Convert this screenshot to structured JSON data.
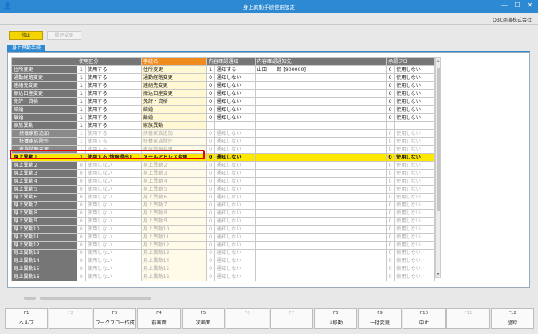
{
  "window": {
    "title": "身上異動手続使用設定",
    "company": "OBC商事株式会社"
  },
  "toolbar": {
    "edit_label": "修正",
    "history_label": "履歴変更"
  },
  "tab": {
    "label": "身上異動手続"
  },
  "columns": {
    "category": "",
    "use": "使用区分",
    "procedure": "手続名",
    "notify": "内容確認通知",
    "notify_to": "内容確認通知先",
    "approval": "承認フロー"
  },
  "rows": [
    {
      "label": "住所変更",
      "sub": false,
      "use_code": "1",
      "use_text": "使用する",
      "proc": "住所変更",
      "n_code": "1",
      "n_text": "通知する",
      "notify_to": "山田　一郎 [900000]",
      "a_code": "0",
      "a_text": "使用しない",
      "dis": false
    },
    {
      "label": "通勤経路変更",
      "sub": false,
      "use_code": "1",
      "use_text": "使用する",
      "proc": "通勤経路変更",
      "n_code": "0",
      "n_text": "通知しない",
      "notify_to": "",
      "a_code": "0",
      "a_text": "使用しない",
      "dis": false
    },
    {
      "label": "連絡先変更",
      "sub": false,
      "use_code": "1",
      "use_text": "使用する",
      "proc": "連絡先変更",
      "n_code": "0",
      "n_text": "通知しない",
      "notify_to": "",
      "a_code": "0",
      "a_text": "使用しない",
      "dis": false
    },
    {
      "label": "振込口座変更",
      "sub": false,
      "use_code": "1",
      "use_text": "使用する",
      "proc": "振込口座変更",
      "n_code": "0",
      "n_text": "通知しない",
      "notify_to": "",
      "a_code": "0",
      "a_text": "使用しない",
      "dis": false
    },
    {
      "label": "免許・資格",
      "sub": false,
      "use_code": "1",
      "use_text": "使用する",
      "proc": "免許・資格",
      "n_code": "0",
      "n_text": "通知しない",
      "notify_to": "",
      "a_code": "0",
      "a_text": "使用しない",
      "dis": false
    },
    {
      "label": "結婚",
      "sub": false,
      "use_code": "1",
      "use_text": "使用する",
      "proc": "結婚",
      "n_code": "0",
      "n_text": "通知しない",
      "notify_to": "",
      "a_code": "0",
      "a_text": "使用しない",
      "dis": false
    },
    {
      "label": "離婚",
      "sub": false,
      "use_code": "1",
      "use_text": "使用する",
      "proc": "離婚",
      "n_code": "0",
      "n_text": "通知しない",
      "notify_to": "",
      "a_code": "0",
      "a_text": "使用しない",
      "dis": false
    },
    {
      "label": "家族異動",
      "sub": false,
      "use_code": "1",
      "use_text": "使用する",
      "proc": "家族異動",
      "n_code": "",
      "n_text": "",
      "notify_to": "",
      "a_code": "",
      "a_text": "",
      "dis": false
    },
    {
      "label": "扶養家族追加",
      "sub": true,
      "use_code": "1",
      "use_text": "使用する",
      "proc": "扶養家族追加",
      "n_code": "0",
      "n_text": "通知しない",
      "notify_to": "",
      "a_code": "0",
      "a_text": "使用しない",
      "dis": true
    },
    {
      "label": "扶養家族除外",
      "sub": true,
      "use_code": "1",
      "use_text": "使用する",
      "proc": "扶養家族除外",
      "n_code": "0",
      "n_text": "通知しない",
      "notify_to": "",
      "a_code": "0",
      "a_text": "使用しない",
      "dis": true
    },
    {
      "label": "家族情報変更",
      "sub": true,
      "use_code": "1",
      "use_text": "使用する",
      "proc": "家族情報変更",
      "n_code": "0",
      "n_text": "通知しない",
      "notify_to": "",
      "a_code": "0",
      "a_text": "使用しない",
      "dis": true
    },
    {
      "label": "身上異動１",
      "sub": false,
      "use_code": "1",
      "use_text": "使用する(情報提出)",
      "proc": "メールアドレス変更",
      "n_code": "0",
      "n_text": "通知しない",
      "notify_to": "",
      "a_code": "0",
      "a_text": "使用しない",
      "dis": false,
      "sel": true
    },
    {
      "label": "身上異動２",
      "sub": false,
      "use_code": "0",
      "use_text": "使用しない",
      "proc": "身上異動２",
      "n_code": "0",
      "n_text": "通知しない",
      "notify_to": "",
      "a_code": "0",
      "a_text": "使用しない",
      "dis": true
    },
    {
      "label": "身上異動３",
      "sub": false,
      "use_code": "0",
      "use_text": "使用しない",
      "proc": "身上異動３",
      "n_code": "0",
      "n_text": "通知しない",
      "notify_to": "",
      "a_code": "0",
      "a_text": "使用しない",
      "dis": true
    },
    {
      "label": "身上異動４",
      "sub": false,
      "use_code": "0",
      "use_text": "使用しない",
      "proc": "身上異動４",
      "n_code": "0",
      "n_text": "通知しない",
      "notify_to": "",
      "a_code": "0",
      "a_text": "使用しない",
      "dis": true
    },
    {
      "label": "身上異動５",
      "sub": false,
      "use_code": "0",
      "use_text": "使用しない",
      "proc": "身上異動５",
      "n_code": "0",
      "n_text": "通知しない",
      "notify_to": "",
      "a_code": "0",
      "a_text": "使用しない",
      "dis": true
    },
    {
      "label": "身上異動６",
      "sub": false,
      "use_code": "0",
      "use_text": "使用しない",
      "proc": "身上異動６",
      "n_code": "0",
      "n_text": "通知しない",
      "notify_to": "",
      "a_code": "0",
      "a_text": "使用しない",
      "dis": true
    },
    {
      "label": "身上異動７",
      "sub": false,
      "use_code": "0",
      "use_text": "使用しない",
      "proc": "身上異動７",
      "n_code": "0",
      "n_text": "通知しない",
      "notify_to": "",
      "a_code": "0",
      "a_text": "使用しない",
      "dis": true
    },
    {
      "label": "身上異動８",
      "sub": false,
      "use_code": "0",
      "use_text": "使用しない",
      "proc": "身上異動８",
      "n_code": "0",
      "n_text": "通知しない",
      "notify_to": "",
      "a_code": "0",
      "a_text": "使用しない",
      "dis": true
    },
    {
      "label": "身上異動９",
      "sub": false,
      "use_code": "0",
      "use_text": "使用しない",
      "proc": "身上異動９",
      "n_code": "0",
      "n_text": "通知しない",
      "notify_to": "",
      "a_code": "0",
      "a_text": "使用しない",
      "dis": true
    },
    {
      "label": "身上異動10",
      "sub": false,
      "use_code": "0",
      "use_text": "使用しない",
      "proc": "身上異動10",
      "n_code": "0",
      "n_text": "通知しない",
      "notify_to": "",
      "a_code": "0",
      "a_text": "使用しない",
      "dis": true
    },
    {
      "label": "身上異動11",
      "sub": false,
      "use_code": "0",
      "use_text": "使用しない",
      "proc": "身上異動11",
      "n_code": "0",
      "n_text": "通知しない",
      "notify_to": "",
      "a_code": "0",
      "a_text": "使用しない",
      "dis": true
    },
    {
      "label": "身上異動12",
      "sub": false,
      "use_code": "0",
      "use_text": "使用しない",
      "proc": "身上異動12",
      "n_code": "0",
      "n_text": "通知しない",
      "notify_to": "",
      "a_code": "0",
      "a_text": "使用しない",
      "dis": true
    },
    {
      "label": "身上異動13",
      "sub": false,
      "use_code": "0",
      "use_text": "使用しない",
      "proc": "身上異動13",
      "n_code": "0",
      "n_text": "通知しない",
      "notify_to": "",
      "a_code": "0",
      "a_text": "使用しない",
      "dis": true
    },
    {
      "label": "身上異動14",
      "sub": false,
      "use_code": "0",
      "use_text": "使用しない",
      "proc": "身上異動14",
      "n_code": "0",
      "n_text": "通知しない",
      "notify_to": "",
      "a_code": "0",
      "a_text": "使用しない",
      "dis": true
    },
    {
      "label": "身上異動15",
      "sub": false,
      "use_code": "0",
      "use_text": "使用しない",
      "proc": "身上異動15",
      "n_code": "0",
      "n_text": "通知しない",
      "notify_to": "",
      "a_code": "0",
      "a_text": "使用しない",
      "dis": true
    },
    {
      "label": "身上異動16",
      "sub": false,
      "use_code": "0",
      "use_text": "使用しない",
      "proc": "身上異動16",
      "n_code": "0",
      "n_text": "通知しない",
      "notify_to": "",
      "a_code": "0",
      "a_text": "使用しない",
      "dis": true
    }
  ],
  "fkeys": [
    {
      "key": "F1",
      "label": "ヘルプ",
      "enabled": true
    },
    {
      "key": "F2",
      "label": "",
      "enabled": false
    },
    {
      "key": "F3",
      "label": "ワークフロー作成",
      "enabled": true
    },
    {
      "key": "F4",
      "label": "前画面",
      "enabled": true
    },
    {
      "key": "F5",
      "label": "次画面",
      "enabled": true
    },
    {
      "key": "F6",
      "label": "",
      "enabled": false
    },
    {
      "key": "F7",
      "label": "",
      "enabled": false
    },
    {
      "key": "F8",
      "label": "↓移動",
      "enabled": true
    },
    {
      "key": "F9",
      "label": "一括変更",
      "enabled": true
    },
    {
      "key": "F10",
      "label": "中止",
      "enabled": true
    },
    {
      "key": "F11",
      "label": "",
      "enabled": false
    },
    {
      "key": "F12",
      "label": "登録",
      "enabled": true
    }
  ],
  "icons": {
    "app": "person-plus-icon",
    "minimize": "minimize-icon",
    "maximize": "maximize-icon",
    "close": "close-icon"
  },
  "colors": {
    "titlebar": "#2d8ad2",
    "edit_button": "#f6d400",
    "header_orange": "#f08c1e",
    "selected_row": "#ffe800",
    "highlight_box": "#e00000"
  }
}
